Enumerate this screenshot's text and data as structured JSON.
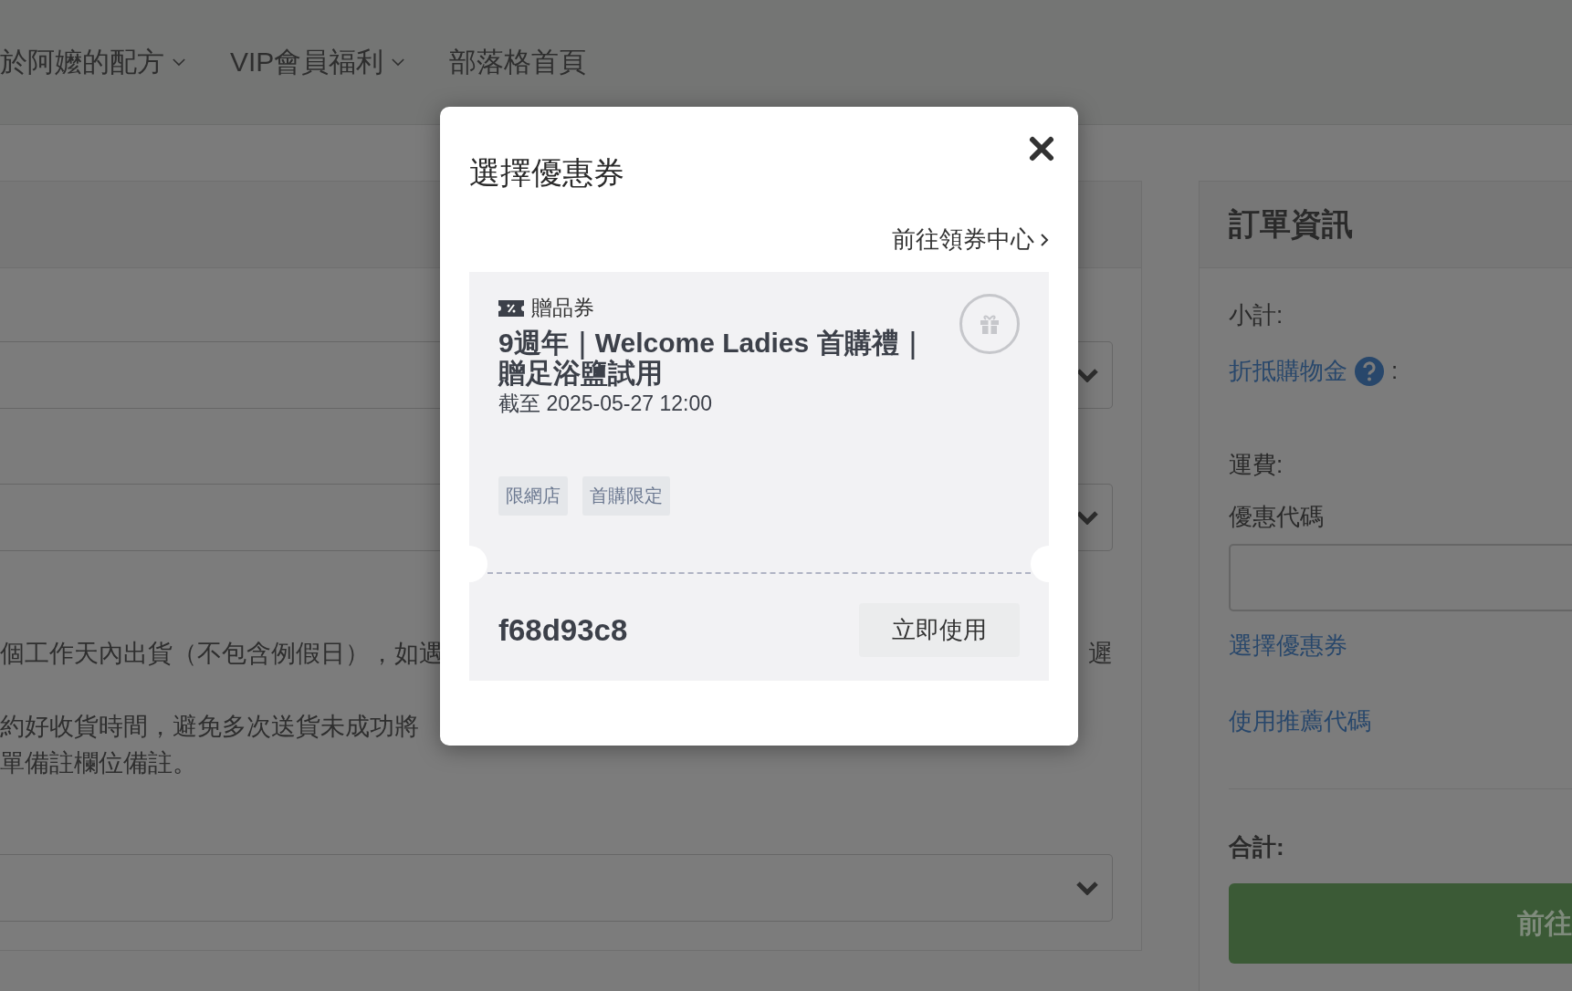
{
  "nav": {
    "items": [
      {
        "label": "於阿嬤的配方",
        "dropdown": true
      },
      {
        "label": "VIP會員福利",
        "dropdown": true
      },
      {
        "label": "部落格首頁",
        "dropdown": false
      }
    ]
  },
  "main_panel": {
    "paragraph_lines": [
      {
        "left": "個工作天內出貨（不包含例假日），如遇",
        "right": "遲"
      },
      {
        "left": "約好收貨時間，避免多次送貨未成功將"
      },
      {
        "left": "單備註欄位備註。"
      }
    ]
  },
  "order_panel": {
    "title": "訂單資訊",
    "subtotal_label": "小計:",
    "credit_link": "折抵購物金",
    "credit_colon": ":",
    "shipping_label": "運費:",
    "promo_label": "優惠代碼",
    "choose_coupon_link": "選擇優惠券",
    "referral_link": "使用推薦代碼",
    "total_label": "合計:",
    "checkout_button": "前往"
  },
  "modal": {
    "title": "選擇優惠券",
    "coupon_center_link": "前往領券中心",
    "coupons": [
      {
        "type": "贈品券",
        "title": "9週年｜Welcome Ladies 首購禮｜贈足浴鹽試用",
        "expiry": "截至 2025-05-27 12:00",
        "tags": [
          "限網店",
          "首購限定"
        ],
        "code": "f68d93c8",
        "button": "立即使用"
      }
    ]
  }
}
